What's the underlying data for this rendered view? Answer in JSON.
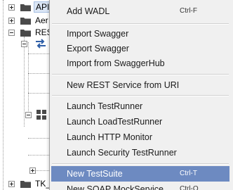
{
  "tree": {
    "nodes": [
      {
        "label": "API"
      },
      {
        "label": "Aer"
      },
      {
        "label": "REST"
      },
      {
        "label": "TK_"
      }
    ]
  },
  "context_menu": {
    "items": [
      {
        "label": "Add WADL",
        "shortcut": "Ctrl-F"
      },
      {
        "label": "Import Swagger",
        "shortcut": ""
      },
      {
        "label": "Export Swagger",
        "shortcut": ""
      },
      {
        "label": "Import from SwaggerHub",
        "shortcut": ""
      },
      {
        "label": "New REST Service from URI",
        "shortcut": ""
      },
      {
        "label": "Launch TestRunner",
        "shortcut": ""
      },
      {
        "label": "Launch LoadTestRunner",
        "shortcut": ""
      },
      {
        "label": "Launch HTTP Monitor",
        "shortcut": ""
      },
      {
        "label": "Launch Security TestRunner",
        "shortcut": ""
      },
      {
        "label": "New TestSuite",
        "shortcut": "Ctrl-T"
      },
      {
        "label": "New SOAP MockService",
        "shortcut": "Ctrl-O"
      }
    ],
    "highlighted_index": 9
  },
  "colors": {
    "menu_background": "#f0f0f0",
    "highlight": "#6d8ac1",
    "folder": "#4a4a4a",
    "swap_icon": "#2f5fa8"
  }
}
